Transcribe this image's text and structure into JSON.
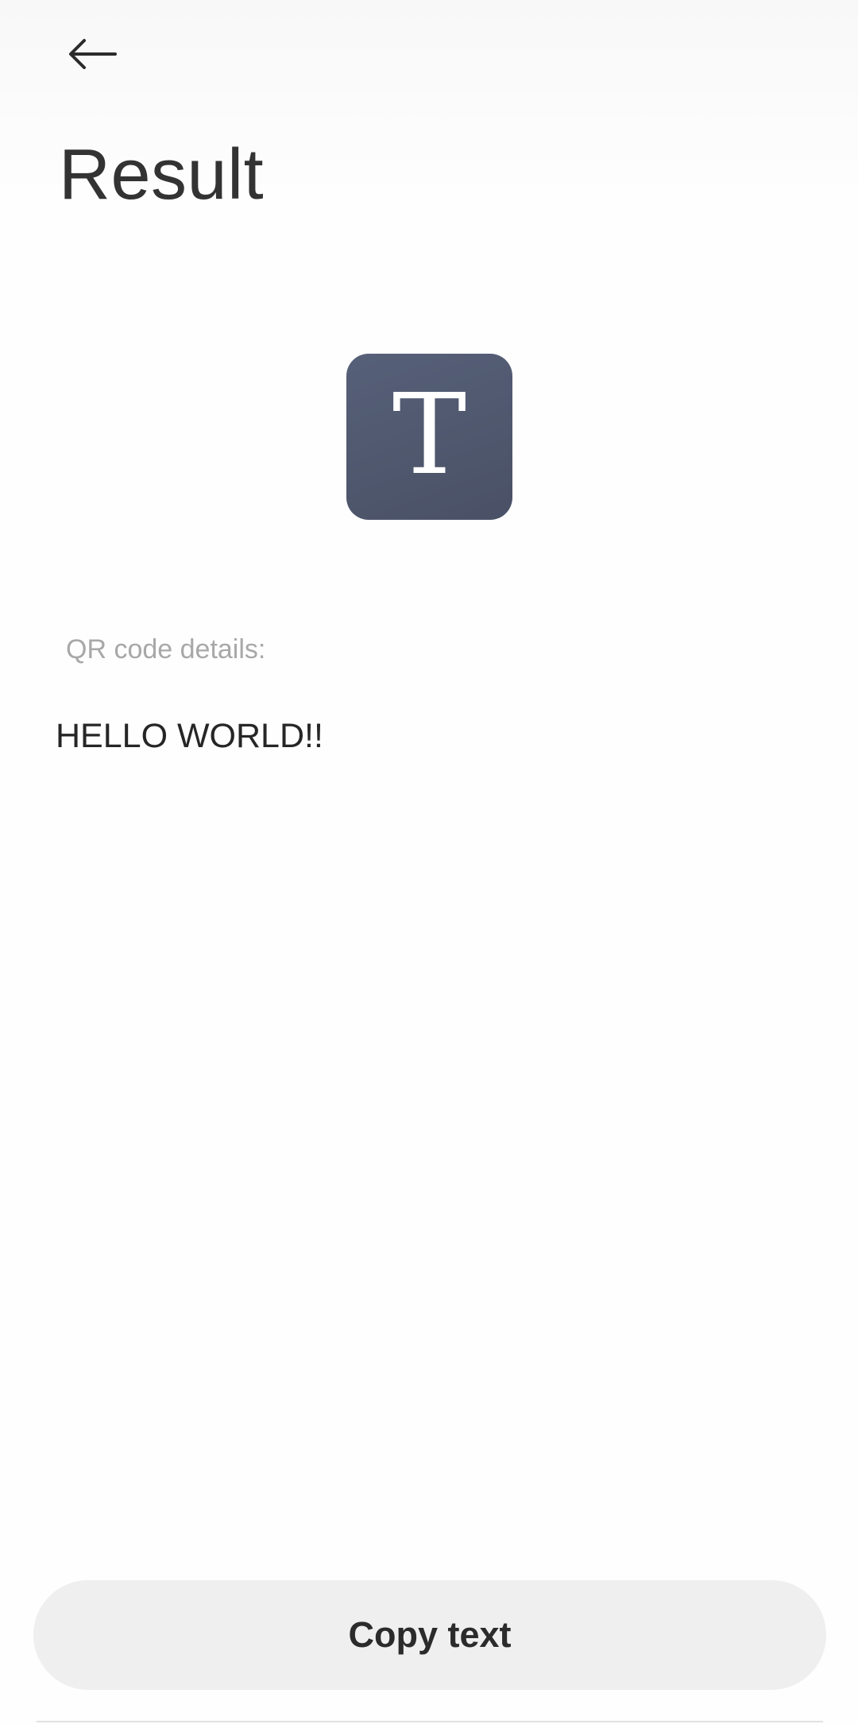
{
  "header": {
    "back_icon": "back-arrow-icon",
    "title": "Result"
  },
  "result_type": {
    "icon": "text-type-icon",
    "glyph": "T",
    "tile_color": "#4f566c"
  },
  "details": {
    "label": "QR code details:",
    "value": "HELLO WORLD!!"
  },
  "actions": {
    "copy_label": "Copy text"
  },
  "colors": {
    "background": "#fefefe",
    "button_background": "#efefef",
    "label_gray": "#a8a8a8"
  }
}
